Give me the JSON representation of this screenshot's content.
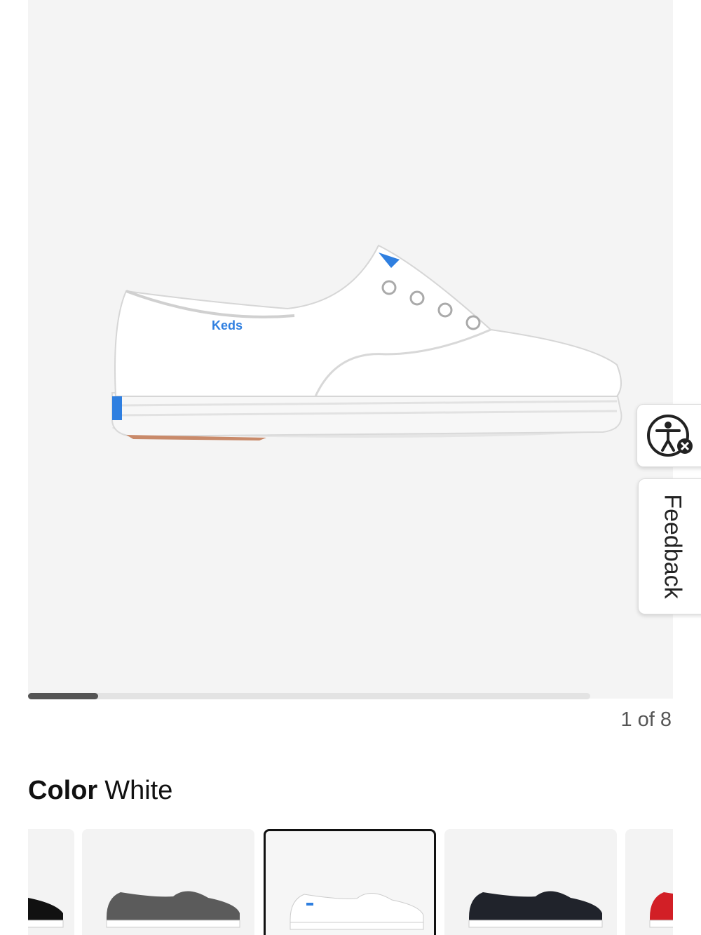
{
  "gallery": {
    "image_alt": "White canvas sneaker",
    "brand_logo_text": "Keds",
    "progress_fraction": 0.125,
    "counter": "1 of 8"
  },
  "color_selector": {
    "label": "Color",
    "value": "White",
    "swatches": [
      {
        "color": "#111111",
        "name": "black"
      },
      {
        "color": "#5b5b5b",
        "name": "gray"
      },
      {
        "color": "#ffffff",
        "name": "white",
        "selected": true
      },
      {
        "color": "#20232b",
        "name": "navy"
      },
      {
        "color": "#d21f26",
        "name": "red"
      }
    ]
  },
  "side_tabs": {
    "accessibility_icon": "accessibility-icon",
    "feedback_label": "Feedback"
  },
  "colors": {
    "brand_blue": "#2f7fe0",
    "progress": "#555555"
  }
}
